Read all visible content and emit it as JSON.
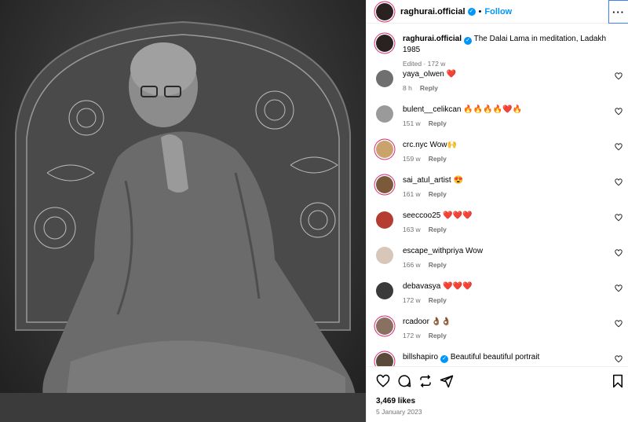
{
  "post": {
    "username": "raghurai.official",
    "follow_label": "Follow",
    "separator": "•",
    "more_label": "···",
    "caption_user": "raghurai.official",
    "caption": "The Dalai Lama in meditation, Ladakh 1985",
    "caption_meta": "Edited · 172 w",
    "likes": "3,469 likes",
    "date": "5 January 2023",
    "reply_label": "Reply"
  },
  "comments": [
    {
      "user": "yaya_olwen",
      "text": "❤️",
      "time": "8 h",
      "avatar_color": "#6f6f6f",
      "ring": false
    },
    {
      "user": "bulent__celikcan",
      "text": "🔥🔥🔥🔥❤️🔥",
      "time": "151 w",
      "avatar_color": "#9a9a9a",
      "ring": false
    },
    {
      "user": "crc.nyc",
      "text": "Wow🙌",
      "time": "159 w",
      "avatar_color": "#c9a36b",
      "ring": true
    },
    {
      "user": "sai_atul_artist",
      "text": "😍",
      "time": "161 w",
      "avatar_color": "#7a5a3a",
      "ring": true
    },
    {
      "user": "seeccoo25",
      "text": "❤️❤️❤️",
      "time": "163 w",
      "avatar_color": "#b53c30",
      "ring": false
    },
    {
      "user": "escape_withpriya",
      "text": "Wow",
      "time": "166 w",
      "avatar_color": "#d8c6b8",
      "ring": false
    },
    {
      "user": "debavasya",
      "text": "❤️❤️❤️",
      "time": "172 w",
      "avatar_color": "#3a3a3a",
      "ring": false
    },
    {
      "user": "rcadoor",
      "text": "👌🏾👌🏾",
      "time": "172 w",
      "avatar_color": "#8a7060",
      "ring": true
    },
    {
      "user": "billshapiro",
      "text": "Beautiful beautiful portrait",
      "time": "",
      "avatar_color": "#5a4a3a",
      "ring": true,
      "verified": true
    }
  ],
  "colors": {
    "link": "#0095f6",
    "ring": "#d62976",
    "meta": "#737373"
  },
  "icons": [
    "heart-icon",
    "comment-icon",
    "repost-icon",
    "share-icon",
    "bookmark-icon"
  ]
}
